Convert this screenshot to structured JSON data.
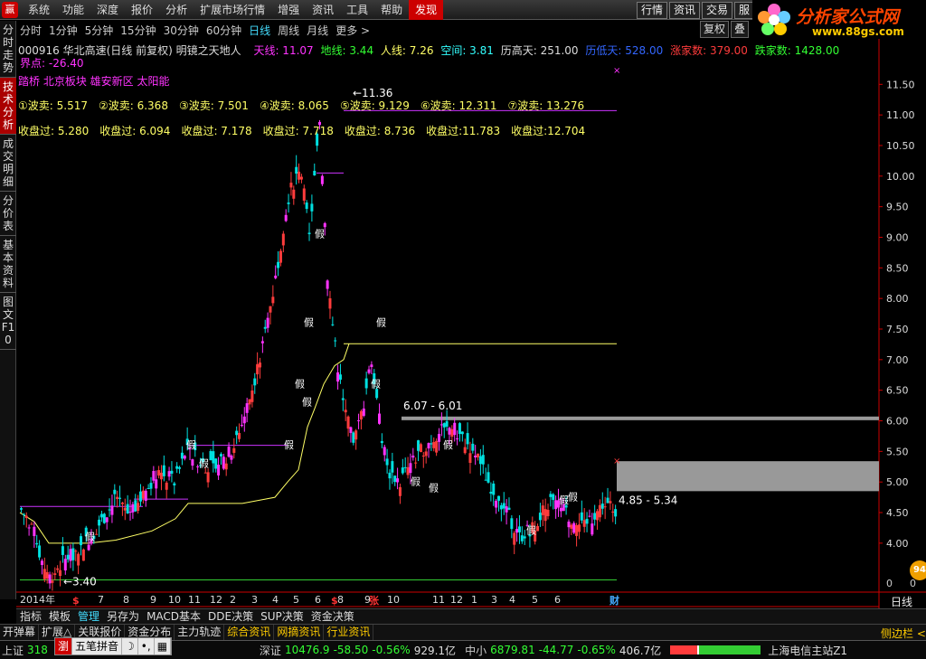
{
  "menu": {
    "logo": "赢",
    "items": [
      "系统",
      "功能",
      "深度",
      "报价",
      "分析",
      "扩展市场行情",
      "增强",
      "资讯",
      "工具",
      "帮助",
      "发现"
    ],
    "highlight_index": 10,
    "right_buttons": [
      "行情",
      "资讯",
      "交易",
      "服"
    ]
  },
  "brand": {
    "name": "分析家公式网",
    "url": "www.88gs.com"
  },
  "periods": {
    "items": [
      "分时",
      "1分钟",
      "5分钟",
      "15分钟",
      "30分钟",
      "60分钟",
      "日线",
      "周线",
      "月线",
      "更多 >"
    ],
    "selected_index": 6,
    "right": [
      "复权",
      "叠"
    ]
  },
  "left_tabs": [
    "分时走势",
    "技术分析",
    "成交明细",
    "分价表",
    "基本资料",
    "图文F10"
  ],
  "left_tabs_active": 1,
  "header": {
    "code_name": "000916 华北高速(日线 前复权) 明镜之天地人",
    "tianxian": "天线: 11.07",
    "dixian": "地线: 3.44",
    "renxian": "人线: 7.26",
    "kongjian": "空间: 3.81",
    "lishigao": "历高天: 251.00",
    "lishidi": "历低天: 528.00",
    "zhangjia": "涨家数: 379.00",
    "diejia": "跌家数: 1428.00",
    "jiedian": "界点: -26.40"
  },
  "concepts": "踏桥 北京板块 雄安新区 太阳能",
  "waves": [
    "①波卖: 5.517",
    "②波卖: 6.368",
    "③波卖: 7.501",
    "④波卖: 8.065",
    "⑤波卖: 9.129",
    "⑥波卖: 12.311",
    "⑦波卖: 13.276"
  ],
  "closes": [
    "收盘过: 5.280",
    "收盘过: 6.094",
    "收盘过: 7.178",
    "收盘过: 7.718",
    "收盘过: 8.736",
    "收盘过:11.783",
    "收盘过:12.704"
  ],
  "colors": {
    "up": "#ff3c3c",
    "down": "#00e0e0",
    "magenta": "#ff33ff",
    "yellow": "#ffff66",
    "green": "#33cc33",
    "gray": "#999999",
    "purple": "#cc33ff"
  },
  "chart_data": {
    "type": "candlestick",
    "ylim": [
      3.2,
      11.8
    ],
    "y_ticks": [
      4,
      4.5,
      5,
      5.5,
      6,
      6.5,
      7,
      7.5,
      8,
      8.5,
      9,
      9.5,
      10,
      10.5,
      11,
      11.5
    ],
    "low_label": "3.40",
    "high_label": "11.36",
    "zone_upper_label": "6.07 - 6.01",
    "zone_lower_label": "4.85 - 5.34",
    "x_labels": [
      "2014年",
      "7",
      "8",
      "9",
      "10",
      "11",
      "12",
      "2",
      "3",
      "4",
      "5",
      "6",
      "8",
      "9",
      "10",
      "11",
      "12",
      "1",
      "3",
      "4",
      "5",
      "6"
    ],
    "x_markers": [
      "$",
      "$",
      "张",
      "财"
    ],
    "tag": "假"
  },
  "right_axis_bottom": [
    "0",
    "0"
  ],
  "daily_label": "日线",
  "badge": "94",
  "bottom_tabs": [
    "指标",
    "模板",
    "管理",
    "另存为",
    "MACD基本",
    "DDE决策",
    "SUP决策",
    "资金决策"
  ],
  "bottom_tabs_selected": 2,
  "bottom2": [
    "开弹幕",
    "扩展△",
    "关联报价",
    "资金分布",
    "主力轨迹",
    "综合资讯",
    "网摘资讯",
    "行业资讯"
  ],
  "side_button": "侧边栏 <",
  "status": {
    "sh_label": "上证",
    "sh_val": "318",
    "sz_label": "深证",
    "sz_val": "10476.9",
    "sz_chg": "-58.50",
    "sz_pct": "-0.56%",
    "sz_amt": "929.1亿",
    "zx_label": "中小",
    "zx_val": "6879.81",
    "zx_chg": "-44.77",
    "zx_pct": "-0.65%",
    "zx_amt": "406.7亿",
    "server": "上海电信主站Z1"
  },
  "ime": [
    "瀏",
    "五笔拼音",
    "☽",
    "•,",
    "▦"
  ]
}
